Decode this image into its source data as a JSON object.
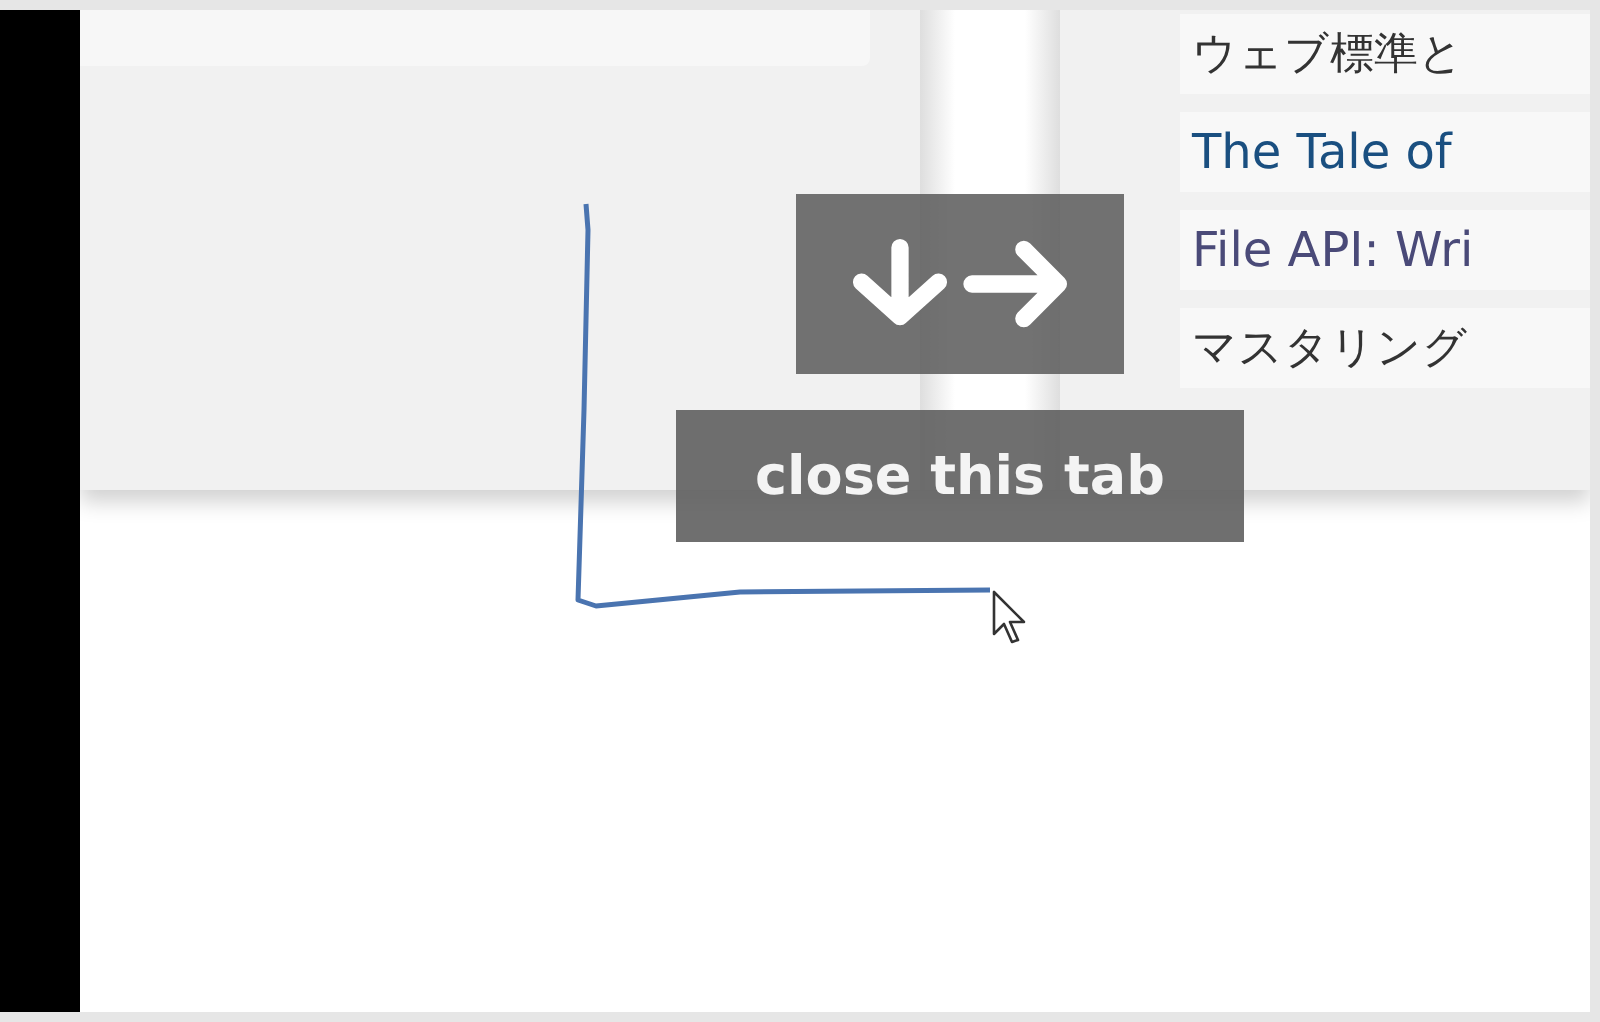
{
  "list_items": [
    {
      "text": "ウェブ標準と",
      "kind": "text"
    },
    {
      "text": "The Tale of",
      "kind": "link"
    },
    {
      "text": "File API: Wri",
      "kind": "visited"
    },
    {
      "text": "マスタリング",
      "kind": "text"
    }
  ],
  "gesture": {
    "label": "close this tab"
  }
}
